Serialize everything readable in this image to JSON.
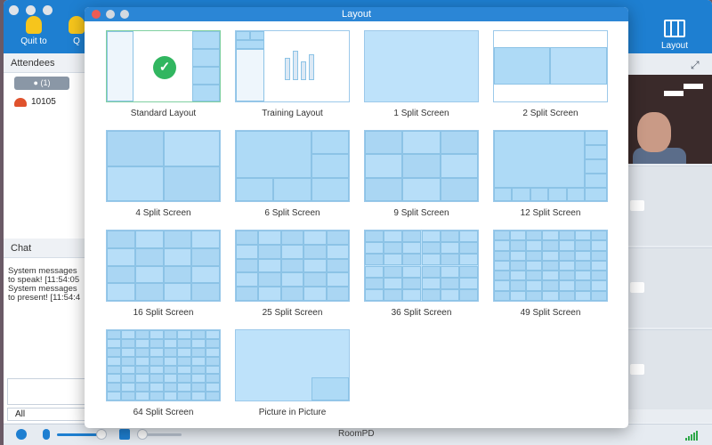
{
  "app": {
    "toolbar": {
      "quit_label": "Quit to",
      "second_label": "Q",
      "layout_label": "Layout"
    },
    "attendees": {
      "header": "Attendees",
      "tab_count": "(1)",
      "user_id": "10105"
    },
    "chat": {
      "header": "Chat",
      "messages": [
        "System messages",
        "to speak! [11:54:05",
        "System messages",
        "to present! [11:54:4"
      ],
      "target": "All"
    },
    "room_name": "RoomPD"
  },
  "dialog": {
    "title": "Layout",
    "layouts": [
      {
        "label": "Standard Layout",
        "selected": true
      },
      {
        "label": "Training Layout"
      },
      {
        "label": "1 Split Screen"
      },
      {
        "label": "2 Split Screen"
      },
      {
        "label": "4 Split Screen"
      },
      {
        "label": "6 Split Screen"
      },
      {
        "label": "9 Split Screen"
      },
      {
        "label": "12 Split Screen"
      },
      {
        "label": "16 Split Screen"
      },
      {
        "label": "25 Split Screen"
      },
      {
        "label": "36 Split Screen"
      },
      {
        "label": "49 Split Screen"
      },
      {
        "label": "64 Split Screen"
      },
      {
        "label": "Picture in Picture"
      }
    ]
  },
  "colors": {
    "accent": "#1e7fd1",
    "thumb_fill": "#bee2fa",
    "selected_check": "#31b660"
  }
}
